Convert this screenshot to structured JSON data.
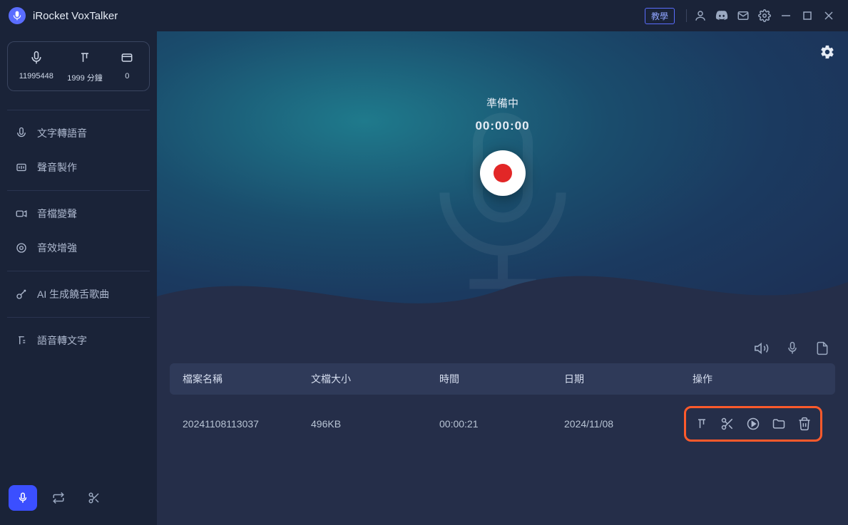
{
  "app": {
    "title": "iRocket VoxTalker"
  },
  "titlebar": {
    "tutorial": "教學"
  },
  "stats": {
    "credits": "11995448",
    "minutes": "1999 分鐘",
    "third": "0"
  },
  "nav": {
    "group1": [
      {
        "label": "文字轉語音"
      },
      {
        "label": "聲音製作"
      }
    ],
    "group2": [
      {
        "label": "音檔變聲"
      },
      {
        "label": "音效增強"
      }
    ],
    "group3": [
      {
        "label": "AI 生成饒舌歌曲"
      }
    ],
    "group4": [
      {
        "label": "語音轉文字"
      }
    ]
  },
  "recorder": {
    "status": "準備中",
    "timer": "00:00:00"
  },
  "table": {
    "headers": {
      "name": "檔案名稱",
      "size": "文檔大小",
      "time": "時間",
      "date": "日期",
      "act": "操作"
    },
    "rows": [
      {
        "name": "20241108113037",
        "size": "496KB",
        "time": "00:00:21",
        "date": "2024/11/08"
      }
    ]
  }
}
